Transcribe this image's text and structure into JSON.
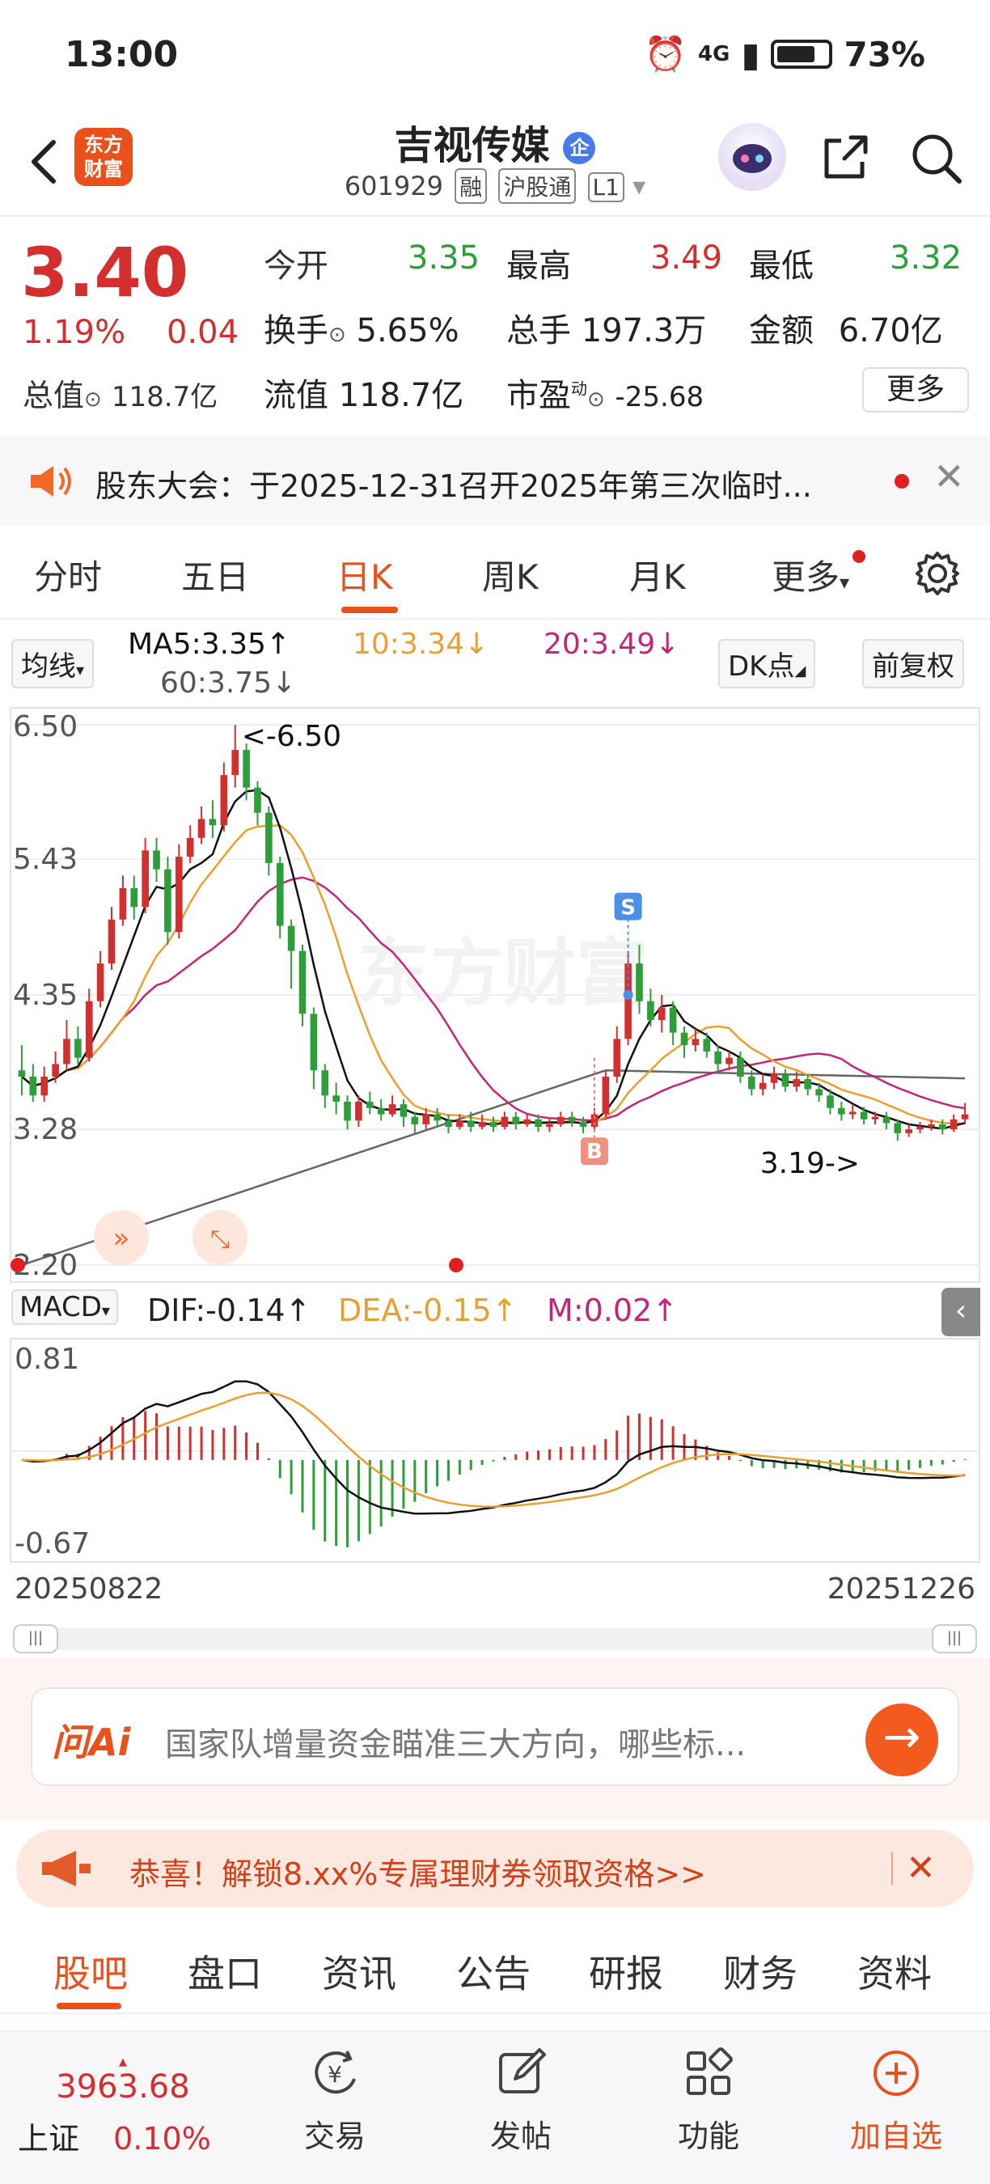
{
  "status_bar": {
    "time": "13:00",
    "network": "4G",
    "battery": "73%"
  },
  "header": {
    "title": "吉视传媒",
    "badge": "企",
    "code": "601929",
    "tag_margin": "融",
    "tag_connect": "沪股通",
    "tag_level": "L1",
    "logo_text_1": "东方",
    "logo_text_2": "财富"
  },
  "quote": {
    "price": "3.40",
    "change_pct": "1.19%",
    "change_amt": "0.04",
    "open_label": "今开",
    "open": "3.35",
    "high_label": "最高",
    "high": "3.49",
    "low_label": "最低",
    "low": "3.32",
    "turnover_label": "换手",
    "turnover": "5.65%",
    "volume_label": "总手",
    "volume": "197.3万",
    "amount_label": "金额",
    "amount": "6.70亿",
    "mkt_cap_label": "总值",
    "mkt_cap": "118.7亿",
    "float_cap_label": "流值",
    "float_cap": "118.7亿",
    "pe_label": "市盈",
    "pe_sup": "动",
    "pe": "-25.68",
    "more_label": "更多"
  },
  "notice": {
    "text": "股东大会：于2025-12-31召开2025年第三次临时..."
  },
  "period_tabs": [
    "分时",
    "五日",
    "日K",
    "周K",
    "月K",
    "更多"
  ],
  "active_period": "日K",
  "ma_row": {
    "type_label": "均线",
    "ma5": "MA5:3.35↑",
    "ma10": "10:3.34↓",
    "ma20": "20:3.49↓",
    "ma60": "60:3.75↓",
    "dk_label": "DK点",
    "adjust_label": "前复权"
  },
  "chart_data": {
    "type": "candlestick",
    "y_ticks": [
      "6.50",
      "5.43",
      "4.35",
      "3.28",
      "2.20"
    ],
    "ylim": [
      2.2,
      6.5
    ],
    "x_start": "20250822",
    "x_end": "20251226",
    "annotations": {
      "high": "<-6.50",
      "low": "3.19->",
      "sell": "S",
      "buy": "B"
    },
    "colors": {
      "up": "#d32f2f",
      "down": "#2e9e3a",
      "ma5": "#111111",
      "ma10": "#e8a030",
      "ma20": "#c2257a",
      "ma60": "#666666"
    },
    "candles": [
      [
        3.75,
        3.7,
        3.95,
        3.55
      ],
      [
        3.7,
        3.55,
        3.8,
        3.5
      ],
      [
        3.55,
        3.7,
        3.78,
        3.5
      ],
      [
        3.7,
        3.8,
        3.9,
        3.65
      ],
      [
        3.8,
        4.0,
        4.15,
        3.75
      ],
      [
        4.0,
        3.85,
        4.1,
        3.8
      ],
      [
        3.85,
        4.3,
        4.4,
        3.82
      ],
      [
        4.3,
        4.6,
        4.7,
        4.25
      ],
      [
        4.6,
        4.95,
        5.05,
        4.55
      ],
      [
        4.95,
        5.2,
        5.3,
        4.9
      ],
      [
        5.2,
        5.05,
        5.3,
        4.95
      ],
      [
        5.05,
        5.5,
        5.6,
        5.0
      ],
      [
        5.5,
        5.35,
        5.6,
        5.25
      ],
      [
        5.35,
        4.85,
        5.45,
        4.75
      ],
      [
        4.85,
        5.45,
        5.55,
        4.8
      ],
      [
        5.45,
        5.6,
        5.7,
        5.4
      ],
      [
        5.6,
        5.75,
        5.85,
        5.55
      ],
      [
        5.75,
        5.7,
        5.9,
        5.6
      ],
      [
        5.7,
        6.1,
        6.2,
        5.65
      ],
      [
        6.1,
        6.3,
        6.5,
        6.0
      ],
      [
        6.3,
        6.0,
        6.35,
        5.9
      ],
      [
        6.0,
        5.8,
        6.05,
        5.7
      ],
      [
        5.8,
        5.4,
        5.85,
        5.3
      ],
      [
        5.4,
        4.9,
        5.45,
        4.8
      ],
      [
        4.9,
        4.7,
        4.95,
        4.4
      ],
      [
        4.7,
        4.2,
        4.75,
        4.1
      ],
      [
        4.2,
        3.75,
        4.25,
        3.6
      ],
      [
        3.75,
        3.55,
        3.8,
        3.45
      ],
      [
        3.55,
        3.5,
        3.65,
        3.4
      ],
      [
        3.5,
        3.35,
        3.55,
        3.28
      ],
      [
        3.35,
        3.5,
        3.55,
        3.3
      ],
      [
        3.5,
        3.45,
        3.58,
        3.4
      ],
      [
        3.45,
        3.4,
        3.52,
        3.35
      ],
      [
        3.4,
        3.48,
        3.55,
        3.38
      ],
      [
        3.48,
        3.38,
        3.52,
        3.3
      ],
      [
        3.38,
        3.32,
        3.42,
        3.25
      ],
      [
        3.32,
        3.4,
        3.45,
        3.28
      ],
      [
        3.4,
        3.35,
        3.45,
        3.3
      ],
      [
        3.35,
        3.3,
        3.4,
        3.25
      ],
      [
        3.3,
        3.35,
        3.4,
        3.28
      ],
      [
        3.35,
        3.3,
        3.42,
        3.26
      ],
      [
        3.3,
        3.34,
        3.4,
        3.28
      ],
      [
        3.34,
        3.3,
        3.38,
        3.26
      ],
      [
        3.3,
        3.38,
        3.42,
        3.28
      ],
      [
        3.38,
        3.32,
        3.42,
        3.28
      ],
      [
        3.32,
        3.36,
        3.4,
        3.3
      ],
      [
        3.36,
        3.3,
        3.4,
        3.26
      ],
      [
        3.3,
        3.32,
        3.36,
        3.26
      ],
      [
        3.32,
        3.38,
        3.42,
        3.3
      ],
      [
        3.38,
        3.34,
        3.42,
        3.3
      ],
      [
        3.34,
        3.3,
        3.38,
        3.25
      ],
      [
        3.3,
        3.4,
        3.45,
        3.28
      ],
      [
        3.4,
        3.7,
        3.75,
        3.38
      ],
      [
        3.7,
        4.0,
        4.1,
        3.65
      ],
      [
        4.0,
        4.6,
        4.7,
        3.95
      ],
      [
        4.6,
        4.3,
        4.75,
        4.2
      ],
      [
        4.3,
        4.15,
        4.4,
        4.1
      ],
      [
        4.15,
        4.25,
        4.35,
        4.05
      ],
      [
        4.25,
        4.05,
        4.3,
        3.95
      ],
      [
        4.05,
        3.95,
        4.1,
        3.85
      ],
      [
        3.95,
        4.0,
        4.08,
        3.9
      ],
      [
        4.0,
        3.9,
        4.05,
        3.85
      ],
      [
        3.9,
        3.8,
        3.95,
        3.72
      ],
      [
        3.8,
        3.85,
        3.9,
        3.75
      ],
      [
        3.85,
        3.7,
        3.9,
        3.65
      ],
      [
        3.7,
        3.6,
        3.75,
        3.55
      ],
      [
        3.6,
        3.65,
        3.72,
        3.55
      ],
      [
        3.65,
        3.72,
        3.78,
        3.6
      ],
      [
        3.72,
        3.62,
        3.76,
        3.58
      ],
      [
        3.62,
        3.68,
        3.74,
        3.58
      ],
      [
        3.68,
        3.6,
        3.72,
        3.55
      ],
      [
        3.6,
        3.55,
        3.65,
        3.5
      ],
      [
        3.55,
        3.45,
        3.6,
        3.4
      ],
      [
        3.45,
        3.4,
        3.5,
        3.35
      ],
      [
        3.4,
        3.42,
        3.48,
        3.36
      ],
      [
        3.42,
        3.36,
        3.46,
        3.32
      ],
      [
        3.36,
        3.38,
        3.42,
        3.32
      ],
      [
        3.38,
        3.33,
        3.42,
        3.28
      ],
      [
        3.33,
        3.25,
        3.36,
        3.19
      ],
      [
        3.25,
        3.28,
        3.32,
        3.22
      ],
      [
        3.28,
        3.3,
        3.34,
        3.25
      ],
      [
        3.3,
        3.32,
        3.36,
        3.27
      ],
      [
        3.32,
        3.28,
        3.36,
        3.24
      ],
      [
        3.28,
        3.36,
        3.4,
        3.26
      ],
      [
        3.36,
        3.4,
        3.49,
        3.32
      ]
    ]
  },
  "macd": {
    "label": "MACD",
    "dif": "DIF:-0.14↑",
    "dea": "DEA:-0.15↑",
    "m": "M:0.02↑",
    "y_top": "0.81",
    "y_bottom": "-0.67"
  },
  "ai": {
    "logo": "问Ai",
    "placeholder": "国家队增量资金瞄准三大方向，哪些标..."
  },
  "promo": {
    "text": "恭喜！解锁8.xx%专属理财券领取资格>>"
  },
  "content_tabs": [
    "股吧",
    "盘口",
    "资讯",
    "公告",
    "研报",
    "财务",
    "资料"
  ],
  "active_content_tab": "股吧",
  "bottom_bar": {
    "index_value": "3963.68",
    "index_name": "上证",
    "index_change": "0.10%",
    "trade": "交易",
    "post": "发帖",
    "functions": "功能",
    "add_watch": "加自选"
  }
}
